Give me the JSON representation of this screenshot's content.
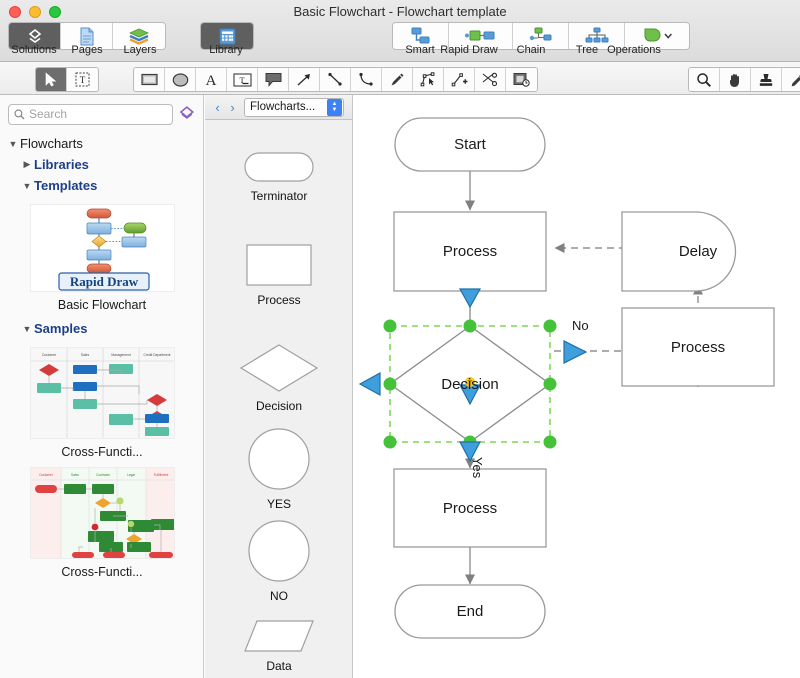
{
  "window": {
    "title": "Basic Flowchart - Flowchart template",
    "traffic_lights": [
      "close",
      "minimize",
      "zoom"
    ]
  },
  "toolbar": {
    "left_group": [
      {
        "label": "Solutions",
        "icon": "solutions-icon",
        "active": true
      },
      {
        "label": "Pages",
        "icon": "pages-icon",
        "active": false
      },
      {
        "label": "Layers",
        "icon": "layers-icon",
        "active": false
      }
    ],
    "library_group": [
      {
        "label": "Library",
        "icon": "library-icon",
        "active": true
      }
    ],
    "right_group": [
      {
        "label": "Smart",
        "icon": "smart-connector-icon"
      },
      {
        "label": "Rapid Draw",
        "icon": "rapid-draw-icon"
      },
      {
        "label": "Chain",
        "icon": "chain-icon"
      },
      {
        "label": "Tree",
        "icon": "tree-icon"
      },
      {
        "label": "Operations",
        "icon": "operations-icon"
      }
    ]
  },
  "tools": {
    "select_group": [
      {
        "name": "pointer-tool",
        "icon": "arrow-cursor-icon",
        "selected": true
      },
      {
        "name": "text-select-tool",
        "icon": "text-box-select-icon",
        "selected": false
      }
    ],
    "shape_group": [
      {
        "name": "rectangle-tool",
        "icon": "rectangle-icon"
      },
      {
        "name": "ellipse-tool",
        "icon": "ellipse-icon"
      },
      {
        "name": "text-tool",
        "icon": "letter-a-icon"
      },
      {
        "name": "text-block-tool",
        "icon": "text-field-icon"
      },
      {
        "name": "callout-tool",
        "icon": "speech-bubble-icon"
      },
      {
        "name": "arrow-tool",
        "icon": "arrow-up-right-icon"
      },
      {
        "name": "line-tool",
        "icon": "straight-line-icon"
      },
      {
        "name": "curve-tool",
        "icon": "curve-line-icon"
      },
      {
        "name": "pen-tool",
        "icon": "pen-nib-icon"
      },
      {
        "name": "edit-points-tool",
        "icon": "edit-node-icon"
      },
      {
        "name": "add-point-tool",
        "icon": "add-node-icon"
      },
      {
        "name": "cut-tool",
        "icon": "scissors-icon"
      },
      {
        "name": "layer-tool",
        "icon": "layer-clock-icon"
      }
    ],
    "right_group": [
      {
        "name": "zoom-tool",
        "icon": "magnifier-icon"
      },
      {
        "name": "hand-tool",
        "icon": "hand-icon"
      },
      {
        "name": "stamp-tool",
        "icon": "stamp-icon"
      },
      {
        "name": "eyedropper-tool",
        "icon": "eyedropper-icon"
      }
    ]
  },
  "sidebar": {
    "search": {
      "placeholder": "Search",
      "value": ""
    },
    "tree": [
      {
        "label": "Flowcharts",
        "level": 0,
        "expanded": true
      },
      {
        "label": "Libraries",
        "level": 1,
        "expanded": false
      },
      {
        "label": "Templates",
        "level": 1,
        "expanded": true
      }
    ],
    "templates": [
      {
        "caption": "Basic Flowchart",
        "badge": "Rapid Draw"
      }
    ],
    "samples_label": "Samples",
    "samples_expanded": true,
    "samples": [
      {
        "caption": "Cross-Functi...",
        "lanes": [
          "Customer",
          "Sales",
          "Management",
          "Credit Department"
        ]
      },
      {
        "caption": "Cross-Functi...",
        "lanes": [
          "Customer",
          "Sales",
          "Contracts",
          "Legal",
          "Fulfillment"
        ]
      }
    ]
  },
  "shape_panel": {
    "back_arrow": "‹",
    "forward_arrow": "›",
    "library_name": "Flowcharts...",
    "shapes": [
      {
        "name": "Terminator",
        "shape": "terminator"
      },
      {
        "name": "Process",
        "shape": "rectangle"
      },
      {
        "name": "Decision",
        "shape": "diamond"
      },
      {
        "name": "YES",
        "shape": "circle"
      },
      {
        "name": "NO",
        "shape": "circle"
      },
      {
        "name": "Data",
        "shape": "parallelogram"
      }
    ]
  },
  "canvas": {
    "nodes": [
      {
        "id": "start",
        "label": "Start",
        "shape": "terminator"
      },
      {
        "id": "process1",
        "label": "Process",
        "shape": "rectangle"
      },
      {
        "id": "delay",
        "label": "Delay",
        "shape": "delay"
      },
      {
        "id": "decision",
        "label": "Decision",
        "shape": "diamond",
        "selected": true
      },
      {
        "id": "process2",
        "label": "Process",
        "shape": "rectangle"
      },
      {
        "id": "process3",
        "label": "Process",
        "shape": "rectangle"
      },
      {
        "id": "end",
        "label": "End",
        "shape": "terminator"
      }
    ],
    "edge_labels": [
      {
        "text": "No",
        "for": "decision-right"
      },
      {
        "text": "Yes",
        "for": "decision-bottom",
        "rotated": true
      }
    ],
    "selection": {
      "handle_color": "#45c13a",
      "dash_color": "#7ed957",
      "handle_count": 8
    }
  },
  "colors": {
    "accent_blue": "#3b82f6",
    "connector_blue": "#3f9fdd",
    "selection_green": "#45c13a",
    "shape_stroke": "#8c8c8c",
    "tree_link": "#1d3f8b"
  }
}
